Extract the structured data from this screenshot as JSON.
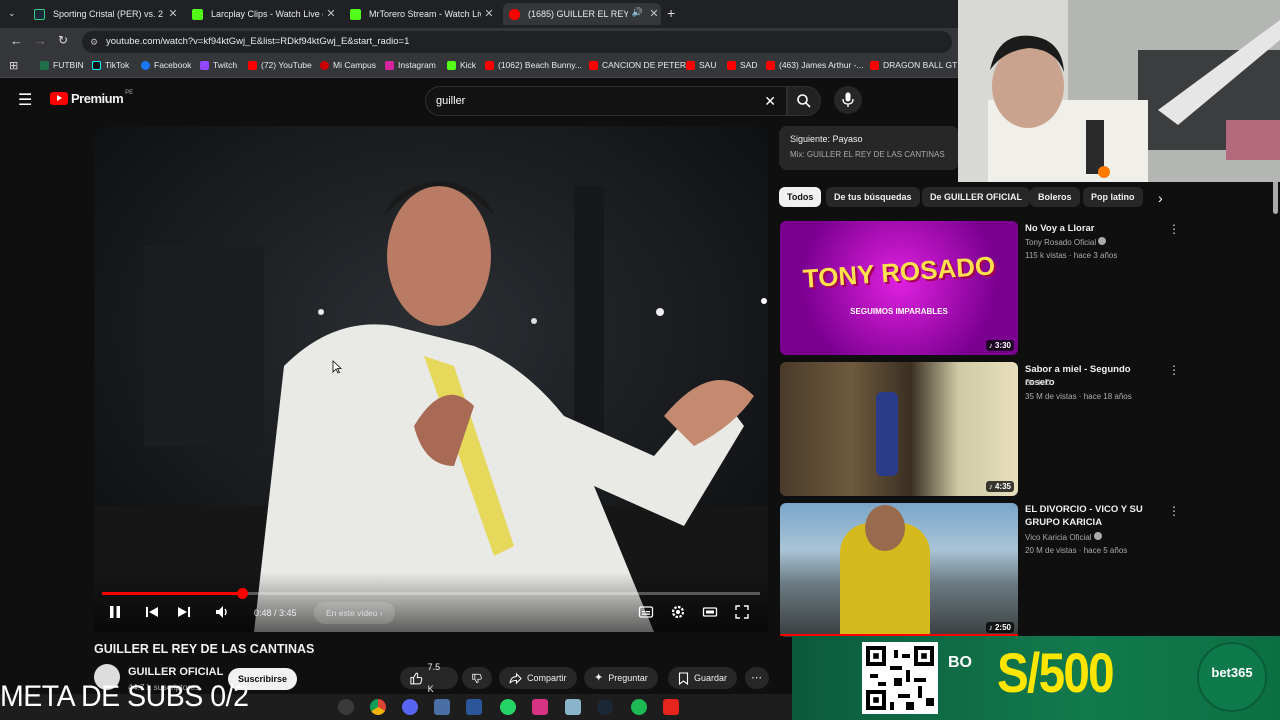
{
  "browser": {
    "tabs": [
      {
        "title": "Sporting Cristal (PER) vs. 2 de M",
        "active": false
      },
      {
        "title": "Larcplay Clips - Watch Live on K",
        "active": false
      },
      {
        "title": "MrTorero Stream - Watch Live",
        "active": false
      },
      {
        "title": "(1685) GUILLER EL REY DE L",
        "active": true
      }
    ],
    "url": "youtube.com/watch?v=kf94ktGwj_E&list=RDkf94ktGwj_E&start_radio=1",
    "bookmarks": [
      "FUTBIN",
      "TikTok",
      "Facebook",
      "Twitch",
      "(72) YouTube",
      "Mi Campus",
      "Instagram",
      "Kick",
      "(1062) Beach Bunny...",
      "CANCION DE PETER",
      "SAU",
      "SAD",
      "(463) James Arthur -...",
      "DRAGON BALL GT"
    ]
  },
  "youtube": {
    "logo": "Premium",
    "region": "PE",
    "search_value": "guiller"
  },
  "video": {
    "time": "0:48 / 3:45",
    "progress": 0.213,
    "in_video": "En este video",
    "title": "GUILLER EL REY DE LAS CANTINAS",
    "channel": "GUILLER OFICIAL",
    "subscribers": "44.7 k suscriptores",
    "subscribe": "Suscribirse",
    "likes": "7.5 K",
    "share": "Compartir",
    "ask": "Preguntar",
    "save": "Guardar"
  },
  "up_next": {
    "title": "Siguiente: Payaso",
    "subtitle": "Mix: GUILLER EL REY DE LAS CANTINAS"
  },
  "chips": [
    "Todos",
    "De tus búsquedas",
    "De GUILLER OFICIAL",
    "Boleros",
    "Pop latino"
  ],
  "recommendations": [
    {
      "title": "No Voy a Llorar",
      "channel": "Tony Rosado Oficial",
      "meta": "115 k vistas · hace 3 años",
      "duration": "3:30",
      "thumb_text": "TONY ROSADO",
      "thumb_sub": "SEGUIMOS IMPARABLES"
    },
    {
      "title": "Sabor a miel - Segundo rosero",
      "channel": "SusixD",
      "meta": "35 M de vistas · hace 18 años",
      "duration": "4:35"
    },
    {
      "title": "EL DIVORCIO - VICO Y SU GRUPO KARICIA",
      "channel": "Vico Karicia Oficial",
      "meta": "20 M de vistas · hace 5 años",
      "duration": "2:50"
    }
  ],
  "ad": {
    "bo": "BO",
    "amount": "S/500",
    "brand": "bet365"
  },
  "overlay": {
    "meta_subs": "META DE SUBS 0/2"
  },
  "colors": {
    "yt_red": "#ff0000",
    "ad_green": "#127a4d",
    "ad_yellow": "#ffe600"
  }
}
